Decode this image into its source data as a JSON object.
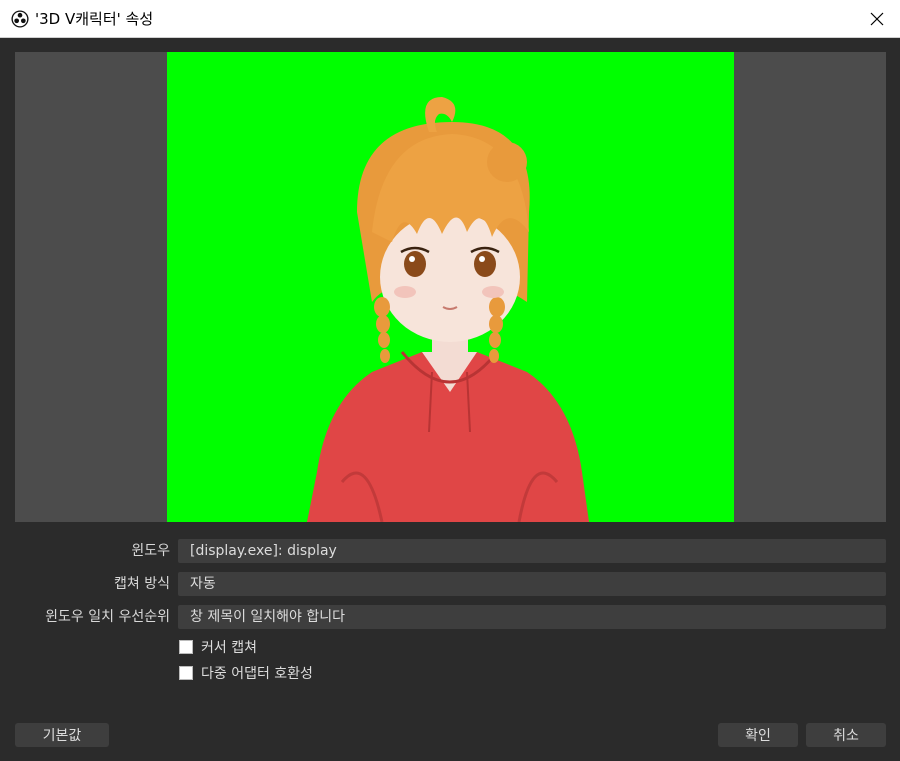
{
  "window": {
    "title": "'3D V캐릭터' 속성",
    "app_icon": "obs-logo-icon",
    "close_icon": "close-icon"
  },
  "form": {
    "window_label": "윈도우",
    "window_value": "[display.exe]: display",
    "capture_method_label": "캡쳐 방식",
    "capture_method_value": "자동",
    "window_match_label": "윈도우 일치 우선순위",
    "window_match_value": "창 제목이 일치해야 합니다",
    "capture_cursor_label": "커서 캡쳐",
    "multi_adapter_label": "다중 어댑터 호환성"
  },
  "buttons": {
    "defaults": "기본값",
    "ok": "확인",
    "cancel": "취소"
  },
  "colors": {
    "chroma_key": "#00ff00",
    "background": "#2b2b2b",
    "field": "#3e3e3e"
  }
}
